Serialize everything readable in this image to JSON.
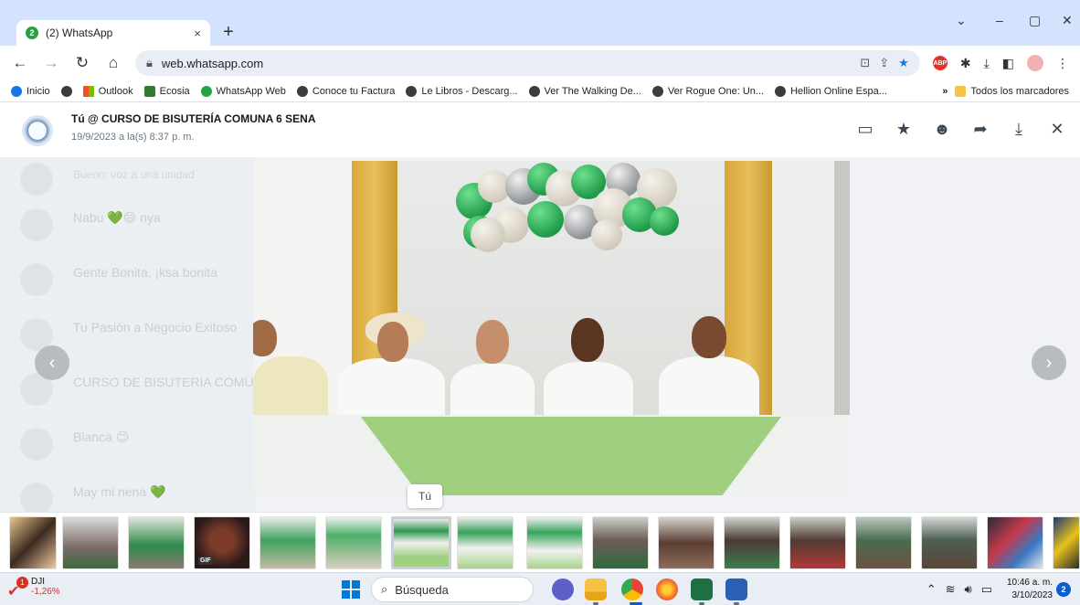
{
  "browser": {
    "tab_title": "(2) WhatsApp",
    "tab_badge": "2",
    "tab_close": "×",
    "new_tab": "+",
    "url": "web.whatsapp.com",
    "window_controls": {
      "min": "–",
      "max": "▢",
      "close": "✕",
      "chevron": "⌄"
    }
  },
  "bookmarks": {
    "items": [
      "Inicio",
      "Outlook",
      "Ecosia",
      "WhatsApp Web",
      "Conoce tu Factura",
      "Le Libros - Descarg...",
      "Ver The Walking De...",
      "Ver Rogue One: Un...",
      "Hellion Online Espa..."
    ],
    "more": "»",
    "all_bookmarks": "Todos los marcadores"
  },
  "viewer": {
    "sender_title": "Tú @ CURSO DE BISUTERÍA COMUNA 6 SENA",
    "sender_date": "19/9/2023 a la(s) 8:37 p. m.",
    "tooltip": "Tú",
    "prev": "‹",
    "next": "›",
    "gif_label": "GIF",
    "background_chats": [
      {
        "name": "",
        "preview": "Bueno: voz a una unidad"
      },
      {
        "name": "Nabu 💚😄 nya",
        "preview": ""
      },
      {
        "name": "Gente Bonita, ¡ksa bonita",
        "preview": ""
      },
      {
        "name": "Tu Pasión a Negocio Exitoso",
        "preview": ""
      },
      {
        "name": "CURSO DE BISUTERIA COMU...",
        "preview": ""
      },
      {
        "name": "Blanca 😊",
        "preview": ""
      },
      {
        "name": "May mi nena 💚",
        "preview": ""
      }
    ]
  },
  "taskbar": {
    "stock_name": "DJI",
    "stock_change": "-1,26%",
    "stock_badge": "1",
    "search_label": "Búsqueda",
    "time": "10:46 a. m.",
    "date": "3/10/2023",
    "notifications": "2"
  }
}
